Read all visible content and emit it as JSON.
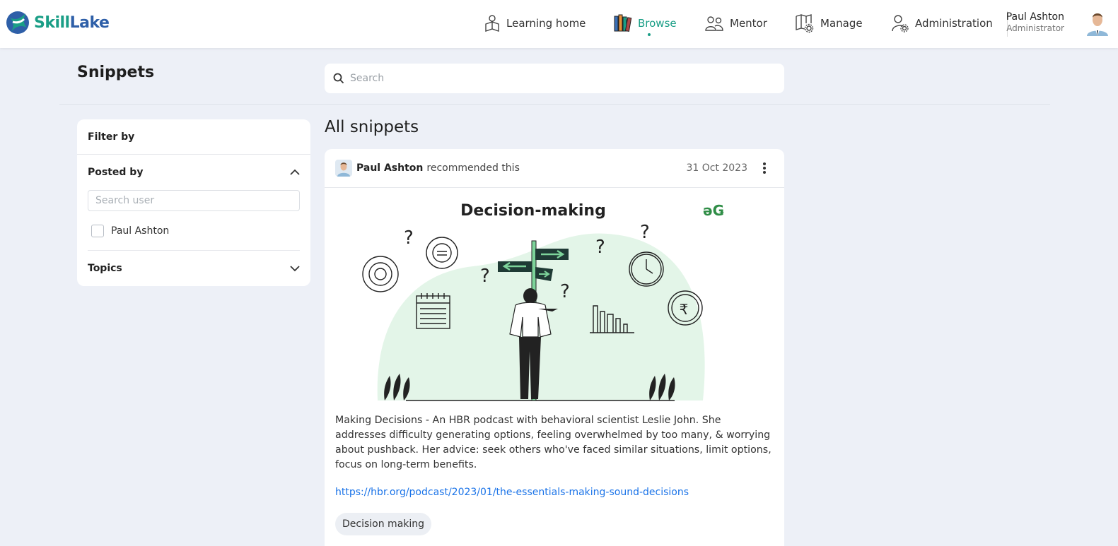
{
  "app": {
    "logo_part1": "Skill",
    "logo_part2": "Lake"
  },
  "nav": [
    {
      "label": "Learning home",
      "icon": "learning-home-icon"
    },
    {
      "label": "Browse",
      "icon": "books-icon",
      "active": true
    },
    {
      "label": "Mentor",
      "icon": "mentor-icon"
    },
    {
      "label": "Manage",
      "icon": "manage-icon"
    },
    {
      "label": "Administration",
      "icon": "admin-icon"
    }
  ],
  "user": {
    "name": "Paul Ashton",
    "role": "Administrator"
  },
  "page": {
    "title": "Snippets",
    "search_placeholder": "Search"
  },
  "filter": {
    "header": "Filter by",
    "posted_by": "Posted by",
    "user_search_placeholder": "Search user",
    "users": [
      "Paul Ashton"
    ],
    "topics": "Topics"
  },
  "main": {
    "section_title": "All snippets",
    "snippet": {
      "poster": "Paul Ashton",
      "action": "recommended this",
      "date": "31 Oct 2023",
      "image_title": "Decision-making",
      "image_logo": "ǝǤ",
      "description": "Making Decisions - An HBR podcast with behavioral scientist Leslie John. She addresses difficulty generating options, feeling overwhelmed by too many, & worrying about pushback. Her advice: seek others who've faced similar situations, limit options, focus on long-term benefits.",
      "link": "https://hbr.org/podcast/2023/01/the-essentials-making-sound-decisions",
      "tag": "Decision making"
    }
  },
  "colors": {
    "accent": "#1a9e86",
    "brand_blue": "#2e5fa8",
    "link": "#1a73e8",
    "background": "#edf0f7"
  }
}
